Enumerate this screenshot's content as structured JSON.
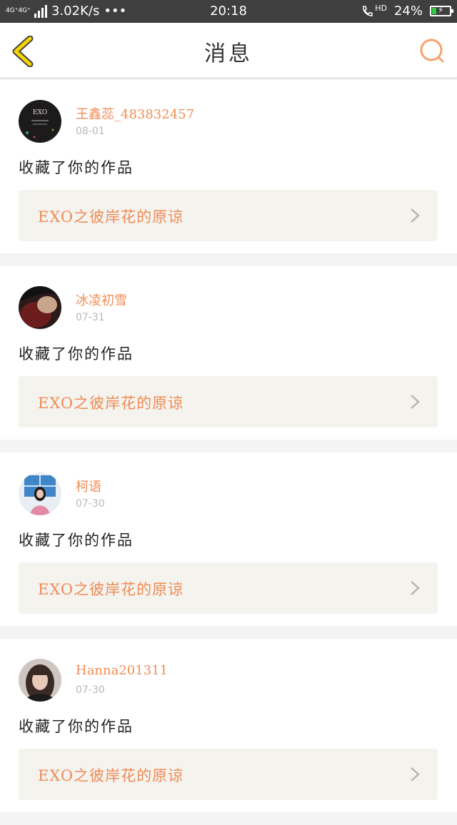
{
  "status_bar": {
    "network": "4G⁺4G⁺",
    "speed": "3.02K/s",
    "dots": "•••",
    "time": "20:18",
    "hd": "HD",
    "battery_percent": "24%",
    "battery_level": 0.24
  },
  "header": {
    "title": "消息"
  },
  "messages": [
    {
      "username": "王鑫蕊_483832457",
      "date": "08-01",
      "action": "收藏了你的作品",
      "work_title": "EXO之彼岸花的原谅",
      "avatar_text": "EXO"
    },
    {
      "username": "冰凌初雪",
      "date": "07-31",
      "action": "收藏了你的作品",
      "work_title": "EXO之彼岸花的原谅"
    },
    {
      "username": "柯语",
      "date": "07-30",
      "action": "收藏了你的作品",
      "work_title": "EXO之彼岸花的原谅"
    },
    {
      "username": "Hanna201311",
      "date": "07-30",
      "action": "收藏了你的作品",
      "work_title": "EXO之彼岸花的原谅"
    }
  ],
  "colors": {
    "accent": "#f28d57",
    "back_icon": "#f5d400",
    "card_bg": "#f4f3ee"
  }
}
